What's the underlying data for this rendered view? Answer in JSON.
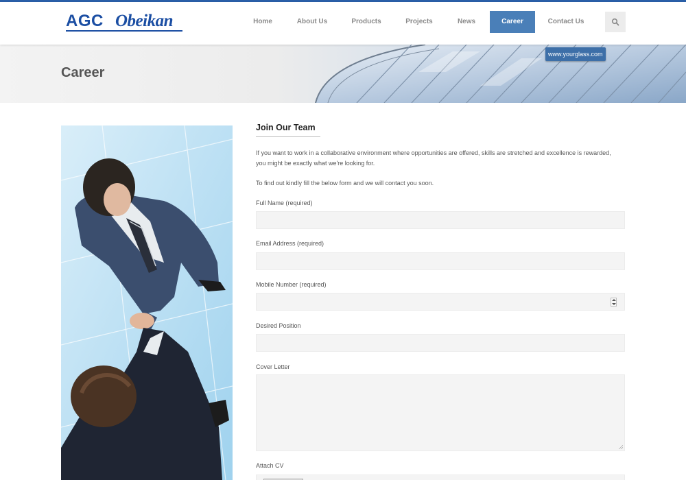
{
  "brand": {
    "logo_text_primary": "AGC",
    "logo_text_secondary": "Obeikan",
    "accent_color": "#4a7fb8",
    "logo_color": "#1b4ea3"
  },
  "nav": {
    "items": [
      {
        "label": "Home",
        "active": false
      },
      {
        "label": "About Us",
        "active": false
      },
      {
        "label": "Products",
        "active": false
      },
      {
        "label": "Projects",
        "active": false
      },
      {
        "label": "News",
        "active": false
      },
      {
        "label": "Career",
        "active": true
      },
      {
        "label": "Contact Us",
        "active": false
      }
    ],
    "search_icon": "search-icon"
  },
  "banner": {
    "title": "Career",
    "badge": "www.yourglass.com"
  },
  "form": {
    "heading": "Join Our Team",
    "intro_1": "If you want to work in a collaborative environment where opportunities are offered, skills are stretched and excellence is rewarded, you might be exactly what we're looking for.",
    "intro_2": "To find out kindly fill the below form and we will contact you soon.",
    "fields": [
      {
        "label": "Full Name (required)",
        "value": ""
      },
      {
        "label": "Email Address (required)",
        "value": ""
      },
      {
        "label": "Mobile Number (required)",
        "value": ""
      },
      {
        "label": "Desired Position",
        "value": ""
      },
      {
        "label": "Cover Letter",
        "value": ""
      },
      {
        "label": "Attach CV",
        "value": ""
      }
    ]
  }
}
